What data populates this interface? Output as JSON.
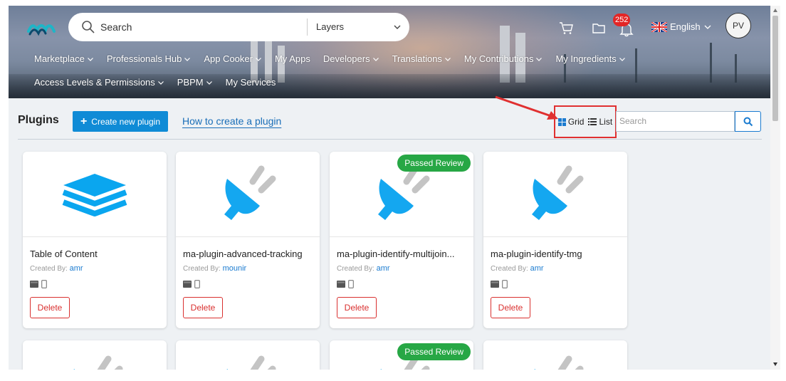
{
  "header": {
    "search_placeholder": "Search",
    "layers_select": "Layers",
    "notifications_count": "252",
    "language": "English",
    "avatar_initials": "PV"
  },
  "nav": {
    "row1": [
      {
        "label": "Marketplace",
        "caret": true
      },
      {
        "label": "Professionals Hub",
        "caret": true
      },
      {
        "label": "App Cooker",
        "caret": true
      },
      {
        "label": "My Apps",
        "caret": false
      },
      {
        "label": "Developers",
        "caret": true
      },
      {
        "label": "Translations",
        "caret": true
      },
      {
        "label": "My Contributions",
        "caret": true
      },
      {
        "label": "My Ingredients",
        "caret": true
      }
    ],
    "row2": [
      {
        "label": "Access Levels & Permissions",
        "caret": true
      },
      {
        "label": "PBPM",
        "caret": true
      },
      {
        "label": "My Services",
        "caret": false
      }
    ]
  },
  "toolbar": {
    "title": "Plugins",
    "create_label": "Create new plugin",
    "howto_label": "How to create a plugin",
    "grid_label": "Grid",
    "list_label": "List",
    "search_placeholder": "Search"
  },
  "cards": [
    {
      "name": "Table of Content",
      "created_label": "Created By:",
      "author": "amr",
      "icon": "layers-icon",
      "review": "",
      "delete_label": "Delete"
    },
    {
      "name": "ma-plugin-advanced-tracking",
      "created_label": "Created By:",
      "author": "mounir",
      "icon": "plug-icon",
      "review": "",
      "delete_label": "Delete"
    },
    {
      "name": "ma-plugin-identify-multijoin...",
      "created_label": "Created By:",
      "author": "amr",
      "icon": "plug-icon",
      "review": "Passed Review",
      "delete_label": "Delete"
    },
    {
      "name": "ma-plugin-identify-tmg",
      "created_label": "Created By:",
      "author": "amr",
      "icon": "plug-icon",
      "review": "",
      "delete_label": "Delete"
    }
  ],
  "cards_row2": [
    {
      "review": ""
    },
    {
      "review": ""
    },
    {
      "review": "Passed Review"
    },
    {
      "review": ""
    }
  ],
  "colors": {
    "primary": "#0f8bd6",
    "danger": "#d9302f",
    "success": "#27a745",
    "plug_blue": "#14a7f0",
    "highlight_red": "#e03030"
  }
}
